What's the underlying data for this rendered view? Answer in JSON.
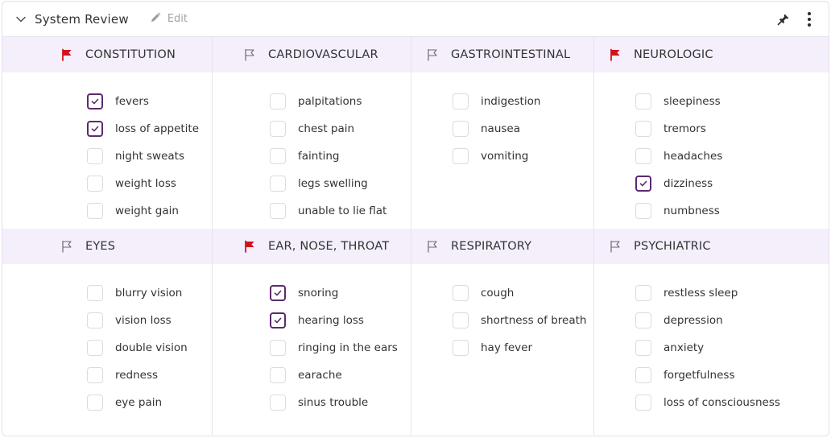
{
  "header": {
    "title": "System Review",
    "edit_label": "Edit",
    "collapse_icon": "chevron-down-icon",
    "edit_icon": "pencil-icon",
    "pin_icon": "pin-icon",
    "menu_icon": "more-vertical-icon"
  },
  "colors": {
    "accent": "#5c2a6e",
    "section_header_bg": "#f4effb",
    "flag_active": "#d4121b",
    "flag_inactive": "#6b6b6b"
  },
  "sections": [
    {
      "title": "CONSTITUTION",
      "flagged": true,
      "items": [
        {
          "label": "fevers",
          "checked": true
        },
        {
          "label": "loss of appetite",
          "checked": true
        },
        {
          "label": "night sweats",
          "checked": false
        },
        {
          "label": "weight loss",
          "checked": false
        },
        {
          "label": "weight gain",
          "checked": false
        }
      ]
    },
    {
      "title": "CARDIOVASCULAR",
      "flagged": false,
      "items": [
        {
          "label": "palpitations",
          "checked": false
        },
        {
          "label": "chest pain",
          "checked": false
        },
        {
          "label": "fainting",
          "checked": false
        },
        {
          "label": "legs swelling",
          "checked": false
        },
        {
          "label": "unable to lie flat",
          "checked": false
        }
      ]
    },
    {
      "title": "GASTROINTESTINAL",
      "flagged": false,
      "items": [
        {
          "label": "indigestion",
          "checked": false
        },
        {
          "label": "nausea",
          "checked": false
        },
        {
          "label": "vomiting",
          "checked": false
        }
      ]
    },
    {
      "title": "NEUROLOGIC",
      "flagged": true,
      "items": [
        {
          "label": "sleepiness",
          "checked": false
        },
        {
          "label": "tremors",
          "checked": false
        },
        {
          "label": "headaches",
          "checked": false
        },
        {
          "label": "dizziness",
          "checked": true
        },
        {
          "label": "numbness",
          "checked": false
        }
      ]
    },
    {
      "title": "EYES",
      "flagged": false,
      "items": [
        {
          "label": "blurry vision",
          "checked": false
        },
        {
          "label": "vision loss",
          "checked": false
        },
        {
          "label": "double vision",
          "checked": false
        },
        {
          "label": "redness",
          "checked": false
        },
        {
          "label": "eye pain",
          "checked": false
        }
      ]
    },
    {
      "title": "EAR, NOSE, THROAT",
      "flagged": true,
      "items": [
        {
          "label": "snoring",
          "checked": true
        },
        {
          "label": "hearing loss",
          "checked": true
        },
        {
          "label": "ringing in the ears",
          "checked": false
        },
        {
          "label": "earache",
          "checked": false
        },
        {
          "label": "sinus trouble",
          "checked": false
        }
      ]
    },
    {
      "title": "RESPIRATORY",
      "flagged": false,
      "items": [
        {
          "label": "cough",
          "checked": false
        },
        {
          "label": "shortness of breath",
          "checked": false
        },
        {
          "label": "hay fever",
          "checked": false
        }
      ]
    },
    {
      "title": "PSYCHIATRIC",
      "flagged": false,
      "items": [
        {
          "label": "restless sleep",
          "checked": false
        },
        {
          "label": "depression",
          "checked": false
        },
        {
          "label": "anxiety",
          "checked": false
        },
        {
          "label": "forgetfulness",
          "checked": false
        },
        {
          "label": "loss of consciousness",
          "checked": false
        }
      ]
    }
  ]
}
